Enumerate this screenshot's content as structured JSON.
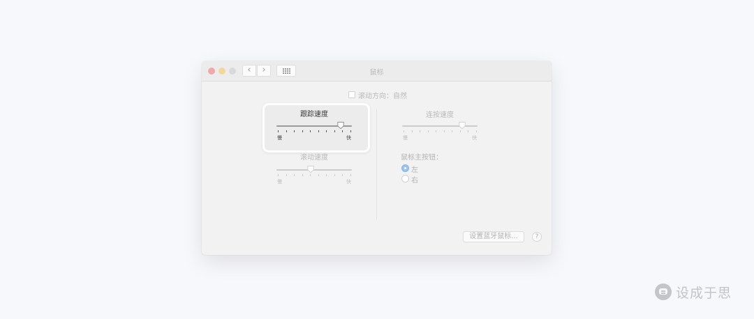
{
  "window": {
    "title": "鼠标",
    "nav_back": "‹",
    "nav_forward": "›"
  },
  "scroll_direction": {
    "label": "滚动方向：自然",
    "checked": false
  },
  "tracking_speed": {
    "title": "跟踪速度",
    "min_label": "慢",
    "max_label": "快",
    "value": 0.85
  },
  "scroll_speed": {
    "title": "滚动速度",
    "min_label": "慢",
    "max_label": "快",
    "value": 0.45
  },
  "double_click_speed": {
    "title": "连按速度",
    "min_label": "慢",
    "max_label": "快",
    "value": 0.8
  },
  "primary_button": {
    "label": "鼠标主按钮：",
    "options": [
      "左",
      "右"
    ],
    "selected": "左"
  },
  "bluetooth_button": {
    "label": "设置蓝牙鼠标..."
  },
  "help_button": {
    "label": "?"
  },
  "watermark": {
    "text": "设成于思"
  },
  "colors": {
    "background": "#f7f8fb",
    "window": "#f2f2f3",
    "radio_selected": "#9cc3ef",
    "close": "#f2a8a8",
    "minimize": "#f2d79b"
  }
}
